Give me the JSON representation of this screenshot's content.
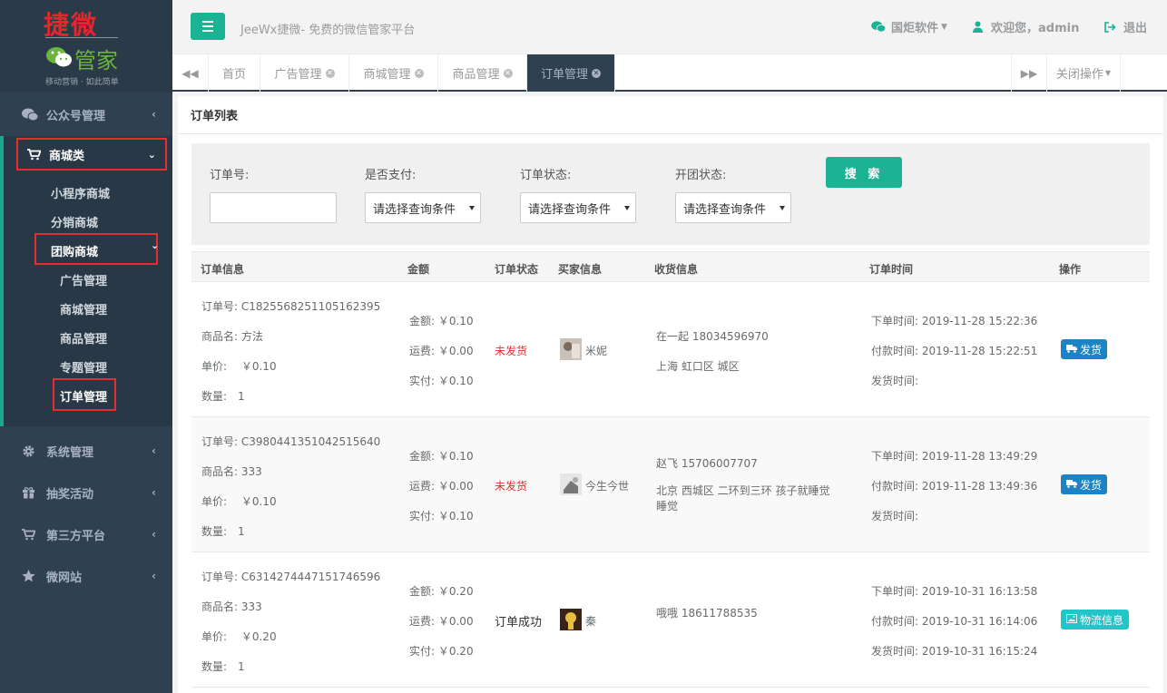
{
  "logo": {
    "main": "捷微",
    "sub": "管家",
    "slogan": "移动营销 · 如此简单"
  },
  "sidebar": {
    "top_item": "公众号管理",
    "category": "商城类",
    "subs": [
      "小程序商城",
      "分销商城",
      "团购商城"
    ],
    "group_subs": [
      "广告管理",
      "商城管理",
      "商品管理",
      "专题管理",
      "订单管理"
    ],
    "bottom_items": [
      "系统管理",
      "抽奖活动",
      "第三方平台",
      "微网站"
    ]
  },
  "header": {
    "title": "JeeWx捷微- 免费的微信管家平台",
    "company": "国炬软件",
    "welcome": "欢迎您，admin",
    "logout": "退出"
  },
  "tabs": {
    "items": [
      "首页",
      "广告管理",
      "商城管理",
      "商品管理",
      "订单管理"
    ],
    "close_ops": "关闭操作"
  },
  "panel": {
    "title": "订单列表"
  },
  "search": {
    "order_no_label": "订单号:",
    "paid_label": "是否支付:",
    "status_label": "订单状态:",
    "group_label": "开团状态:",
    "select_placeholder": "请选择查询条件",
    "button": "搜 索"
  },
  "table": {
    "headers": [
      "订单信息",
      "金额",
      "订单状态",
      "买家信息",
      "收货信息",
      "订单时间",
      "操作"
    ],
    "rows": [
      {
        "order_no": "订单号: C1825568251105162395",
        "product": "商品名: 方法",
        "price": "单价:　 ￥0.10",
        "qty": "数量:　1",
        "amount": "金额: ￥0.10",
        "freight": "运费: ￥0.00",
        "paid": "实付: ￥0.10",
        "status": "未发货",
        "buyer": "米妮",
        "receiver": "在一起  18034596970",
        "address": "上海 虹口区 城区",
        "order_time": "下单时间: 2019-11-28 15:22:36",
        "pay_time": "付款时间: 2019-11-28 15:22:51",
        "ship_time": "发货时间:",
        "action": "发货"
      },
      {
        "order_no": "订单号: C3980441351042515640",
        "product": "商品名: 333",
        "price": "单价:　 ￥0.10",
        "qty": "数量:　1",
        "amount": "金额: ￥0.10",
        "freight": "运费: ￥0.00",
        "paid": "实付: ￥0.10",
        "status": "未发货",
        "buyer": "今生今世",
        "receiver": "赵飞  15706007707",
        "address": "北京 西城区 二环到三环 孩子就睡觉睡觉",
        "order_time": "下单时间: 2019-11-28 13:49:29",
        "pay_time": "付款时间: 2019-11-28 13:49:36",
        "ship_time": "发货时间:",
        "action": "发货"
      },
      {
        "order_no": "订单号: C6314274447151746596",
        "product": "商品名: 333",
        "price": "单价:　 ￥0.20",
        "qty": "数量:　1",
        "amount": "金额: ￥0.20",
        "freight": "运费: ￥0.00",
        "paid": "实付: ￥0.20",
        "status": "订单成功",
        "buyer": "秦",
        "receiver": "哦哦  18611788535",
        "address": "",
        "order_time": "下单时间: 2019-10-31 16:13:58",
        "pay_time": "付款时间: 2019-10-31 16:14:06",
        "ship_time": "发货时间: 2019-10-31 16:15:24",
        "action": "物流信息"
      }
    ]
  },
  "colors": {
    "sidebar": "#2f4050",
    "accent": "#1ab394",
    "ship_btn": "#1c84c6",
    "logistics_btn": "#23c6c8",
    "highlight_box": "#e52e2e"
  }
}
